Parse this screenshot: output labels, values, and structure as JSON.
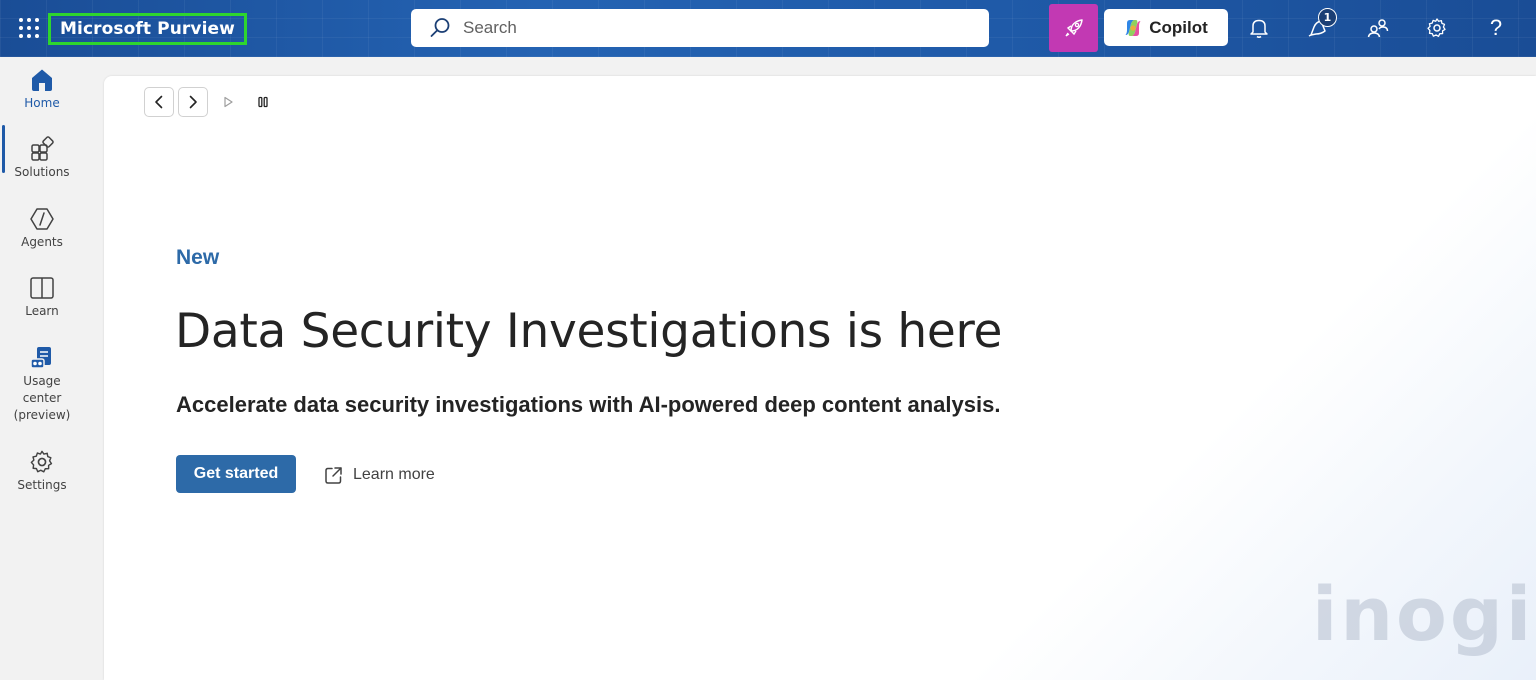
{
  "topbar": {
    "app_title": "Microsoft Purview",
    "search": {
      "placeholder": "Search",
      "value": ""
    },
    "copilot_label": "Copilot",
    "notification_count": "1",
    "help_glyph": "?",
    "icons": [
      "app-launcher-icon",
      "search-icon",
      "rocket-icon",
      "copilot-icon",
      "bell-icon",
      "megaphone-icon",
      "people-icon",
      "gear-icon",
      "help-icon"
    ],
    "colors": {
      "accent_rocket": "#c239b3",
      "frame_highlight": "#2ed52e",
      "topbar_bg": "#1f5aa8"
    }
  },
  "rail": {
    "items": [
      {
        "label": "Home",
        "icon": "home-icon",
        "active": true
      },
      {
        "label": "Solutions",
        "icon": "solutions-icon",
        "active": false
      },
      {
        "label": "Agents",
        "icon": "agents-icon",
        "active": false
      },
      {
        "label": "Learn",
        "icon": "book-icon",
        "active": false
      },
      {
        "label": "Usage center (preview)",
        "icon": "usage-center-icon",
        "active": false
      },
      {
        "label": "Settings",
        "icon": "gear-icon",
        "active": false
      }
    ]
  },
  "main": {
    "eyebrow": "New",
    "headline": "Data Security Investigations is here",
    "subline": "Accelerate data security investigations with AI-powered deep content analysis.",
    "primary_button": "Get started",
    "link_label": "Learn more",
    "carousel_icons": [
      "chevron-left-icon",
      "chevron-right-icon",
      "play-icon",
      "pause-icon"
    ],
    "colors": {
      "accent": "#2d6aa8"
    }
  },
  "watermark": {
    "text": "inogic"
  }
}
